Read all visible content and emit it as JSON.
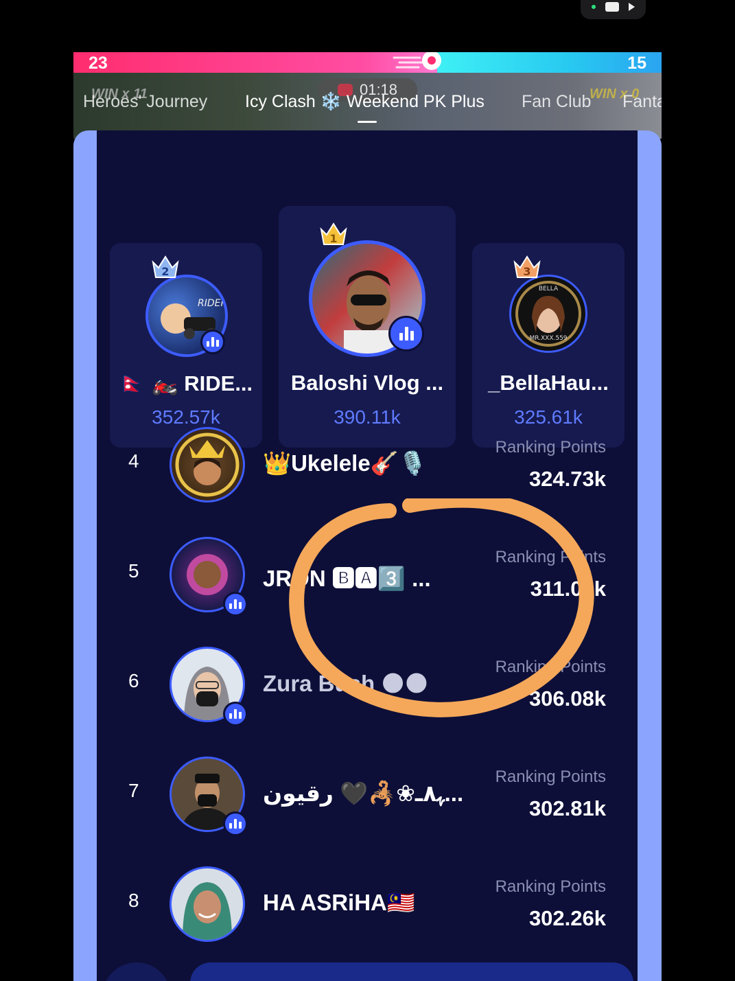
{
  "status": {
    "icons": [
      "green-dot",
      "camera-icon",
      "play-icon"
    ]
  },
  "pk": {
    "left_score": "23",
    "right_score": "15",
    "timer": "01:18",
    "left_win": "WIN x 11",
    "right_win": "WIN x 0"
  },
  "tabs": [
    {
      "label": "Heroes' Journey"
    },
    {
      "label": "Icy Clash ❄️ Weekend PK Plus"
    },
    {
      "label": "Fan Club"
    },
    {
      "label": "Fanta"
    }
  ],
  "podium": [
    {
      "rank": "1",
      "name": "Baloshi Vlog ...",
      "score": "390.11k"
    },
    {
      "rank": "2",
      "name": "🇳🇵 🏍️ RIDE...",
      "score": "352.57k"
    },
    {
      "rank": "3",
      "name": "_BellaHau...",
      "score": "325.61k"
    }
  ],
  "ranking_label": "Ranking Points",
  "rows": [
    {
      "rank": "4",
      "name": "👑Ukelele🎸🎙️",
      "score": "324.73k"
    },
    {
      "rank": "5",
      "name": "JRON 🅱🅰3️⃣ ...",
      "score": "311.06k"
    },
    {
      "rank": "6",
      "name": "Zura Bush 🌑🌑",
      "score": "306.08k"
    },
    {
      "rank": "7",
      "name": "ﮩ٨ـ❀🦂🖤 رقيون...",
      "score": "302.81k"
    },
    {
      "rank": "8",
      "name": "HA ASRiHA🇲🇾",
      "score": "302.26k"
    }
  ],
  "colors": {
    "accent": "#3d5cff",
    "panel_bg": "#0d0f38",
    "side_bg": "#8ba5ff",
    "score_blue": "#5f7bff",
    "annotation": "#f5a85a"
  }
}
